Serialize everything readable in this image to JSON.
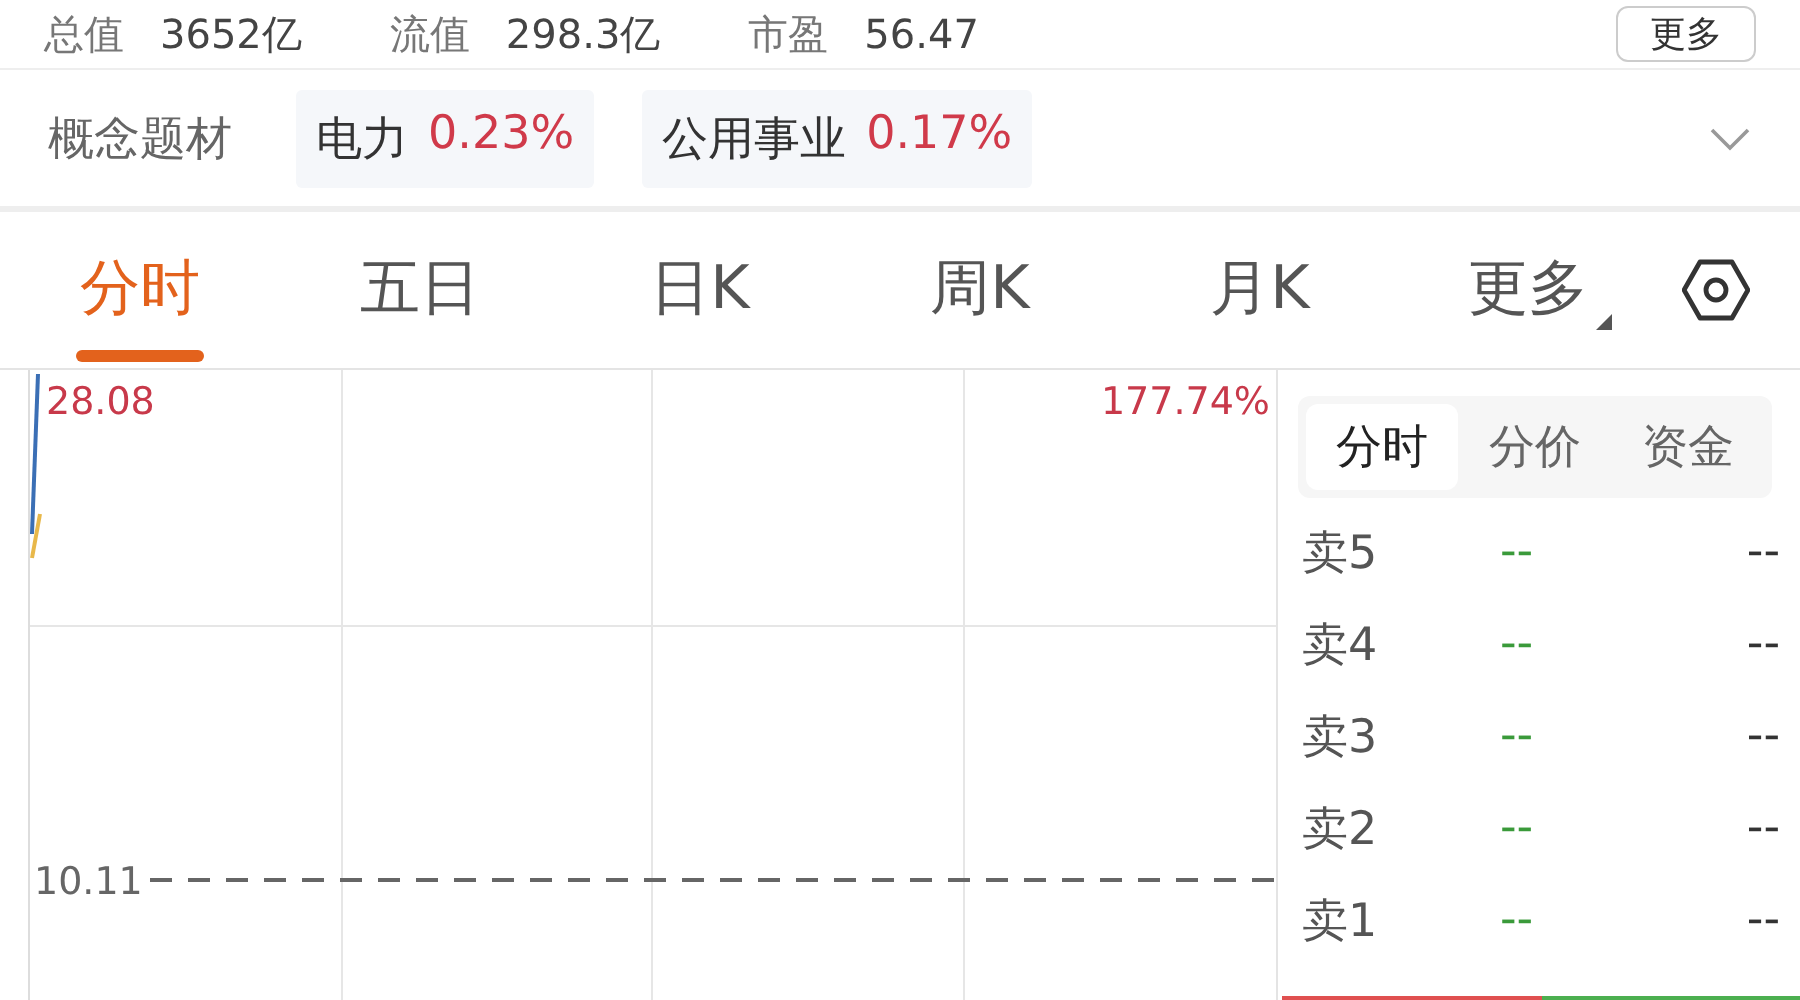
{
  "summary": {
    "stats": [
      {
        "label": "总值",
        "value": "3652亿"
      },
      {
        "label": "流值",
        "value": "298.3亿"
      },
      {
        "label": "市盈",
        "value": "56.47"
      }
    ],
    "more_button": "更多"
  },
  "concepts": {
    "label": "概念题材",
    "expanded": false,
    "tags": [
      {
        "name": "电力",
        "change": "0.23%"
      },
      {
        "name": "公用事业",
        "change": "0.17%"
      }
    ]
  },
  "period_tabs": [
    {
      "label": "分时",
      "selected": true,
      "kind": "tab"
    },
    {
      "label": "五日",
      "selected": false,
      "kind": "tab"
    },
    {
      "label": "日K",
      "selected": false,
      "kind": "tab"
    },
    {
      "label": "周K",
      "selected": false,
      "kind": "tab"
    },
    {
      "label": "月K",
      "selected": false,
      "kind": "tab"
    },
    {
      "label": "更多",
      "selected": false,
      "kind": "dropdown"
    }
  ],
  "chart": {
    "high_price": "28.08",
    "high_change": "177.74%",
    "prev_close": "10.11"
  },
  "order_book": {
    "tabs": [
      {
        "label": "分时",
        "selected": true
      },
      {
        "label": "分价",
        "selected": false
      },
      {
        "label": "资金",
        "selected": false
      }
    ],
    "rows": [
      {
        "label": "卖5",
        "price": "--",
        "volume": "--"
      },
      {
        "label": "卖4",
        "price": "--",
        "volume": "--"
      },
      {
        "label": "卖3",
        "price": "--",
        "volume": "--"
      },
      {
        "label": "卖2",
        "price": "--",
        "volume": "--"
      },
      {
        "label": "卖1",
        "price": "--",
        "volume": "--"
      }
    ],
    "level": 0.5
  }
}
